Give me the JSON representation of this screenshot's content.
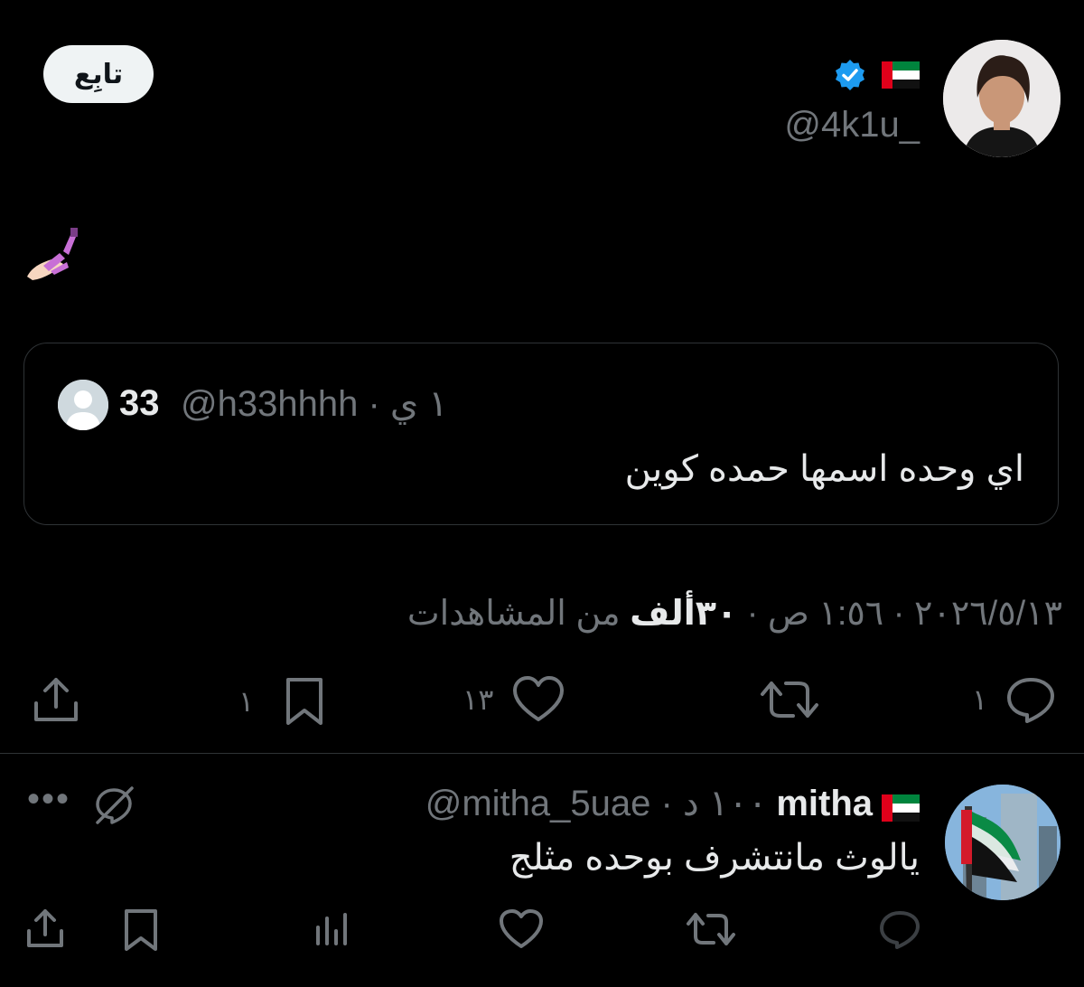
{
  "header": {
    "follow_label": "تابِع",
    "handle": "@4k1u_",
    "verified_icon": "verified-badge-icon",
    "flag_icon": "uae-flag-icon"
  },
  "tweet": {
    "emoji_icon": "nail-polish-emoji"
  },
  "quote": {
    "name": "33",
    "meta": "@h33hhhh · ١ ي",
    "text": "اي وحده اسمها حمده كوين"
  },
  "meta": {
    "date": "٢٠٢٦/٥/١٣",
    "time": "١:٥٦ ص",
    "views_count": "٣٠ألف",
    "views_label": "من المشاهدات"
  },
  "actions": {
    "reply_count": "١",
    "like_count": "١٣",
    "bookmark_count": "١"
  },
  "reply": {
    "name": "mitha",
    "handle_time": "@mitha_5uae · ١٠٠ د",
    "text": "يالوث مانتشرف بوحده مثلج",
    "more": "•••"
  },
  "colors": {
    "background": "#000000",
    "primary_text": "#e7e9ea",
    "secondary_text": "#71767b",
    "verified_blue": "#1d9bf0",
    "follow_bg": "#eff3f4"
  }
}
